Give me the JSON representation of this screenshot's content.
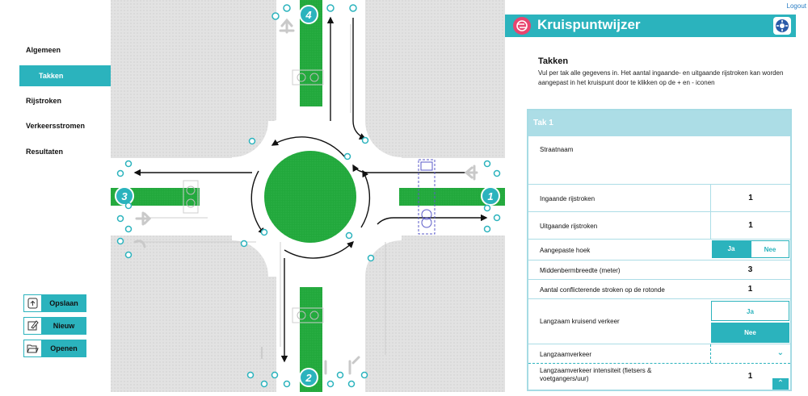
{
  "nav": {
    "items": [
      "Algemeen",
      "Takken",
      "Rijstroken",
      "Verkeersstromen",
      "Resultaten"
    ],
    "active_index": 1,
    "actions": [
      {
        "label": "Opslaan",
        "icon": "save-icon"
      },
      {
        "label": "Nieuw",
        "icon": "edit-icon"
      },
      {
        "label": "Openen",
        "icon": "folder-open-icon"
      }
    ]
  },
  "map": {
    "branches": [
      "1",
      "2",
      "3",
      "4"
    ],
    "colors": {
      "grass": "#22a83c",
      "road": "#ffffff",
      "block": "#d9d9d9",
      "accent": "#2bb3bd",
      "arrow": "#111111",
      "bike": "#5a5ac8"
    }
  },
  "header": {
    "logout": "Logout",
    "title": "Kruispuntwijzer"
  },
  "section": {
    "title": "Takken",
    "description": "Vul per tak alle gegevens in.  Het aantal ingaande- en uitgaande rijstroken kan worden aangepast in het kruispunt door te klikken op de + en - iconen"
  },
  "form": {
    "tak_title": "Tak 1",
    "street_label": "Straatnaam",
    "in_lanes_label": "Ingaande rijstroken",
    "in_lanes_value": "1",
    "out_lanes_label": "Uitgaande rijstroken",
    "out_lanes_value": "1",
    "angle_label": "Aangepaste hoek",
    "yes": "Ja",
    "no": "Nee",
    "median_label": "Middenbermbreedte (meter)",
    "median_value": "3",
    "conflict_label": "Aantal conflicterende stroken op de rotonde",
    "conflict_value": "1",
    "slow_cross_label": "Langzaam kruisend verkeer",
    "slow_traffic_label": "Langzaamverkeer",
    "slow_intensity_label": "Langzaamverkeer intensiteit (fietsers & voetgangers/uur)",
    "slow_intensity_value": "1"
  }
}
